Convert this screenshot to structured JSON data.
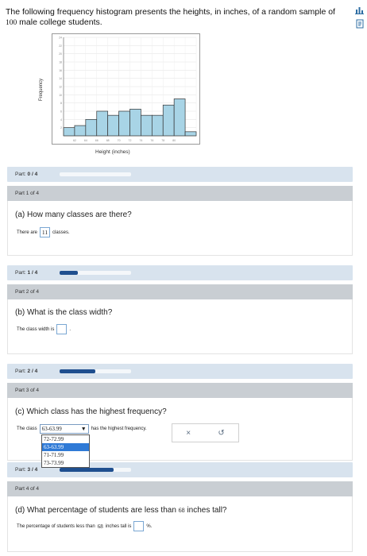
{
  "intro": {
    "text_before": "The following frequency histogram presents the heights, in inches, of a random sample of",
    "sample_size": "100",
    "text_after": "male college students."
  },
  "icons": [
    "chart-icon",
    "notes-icon"
  ],
  "chart_data": {
    "type": "bar",
    "xlabel": "Height (inches)",
    "ylabel": "Frequency",
    "x_ticks": [
      "62",
      "64",
      "66",
      "68",
      "70",
      "72",
      "74",
      "76",
      "78",
      "80"
    ],
    "y_ticks": [
      "2",
      "4",
      "6",
      "8",
      "10",
      "12",
      "14",
      "16",
      "18",
      "20",
      "22",
      "24"
    ],
    "ylim": [
      0,
      24
    ],
    "values": [
      2,
      2.5,
      4,
      6,
      5,
      6,
      6.5,
      5,
      5,
      7.5,
      9,
      1
    ],
    "colors": {
      "bar": "#a8d4e6",
      "edge": "#333333"
    }
  },
  "parts": [
    {
      "status": "Part:",
      "progress": "0 / 4",
      "fraction": 0.0,
      "header": "Part 1 of 4",
      "question": "(a) How many classes are there?",
      "answer_before": "There are",
      "answer_value": "11",
      "answer_after": "classes."
    },
    {
      "status": "Part:",
      "progress": "1 / 4",
      "fraction": 0.25,
      "header": "Part 2 of 4",
      "question": "(b) What is the class width?",
      "answer_before": "The class width is",
      "answer_after": "."
    },
    {
      "status": "Part:",
      "progress": "2 / 4",
      "fraction": 0.5,
      "header": "Part 3 of 4",
      "question": "(c) Which class has the highest frequency?",
      "answer_before": "The class",
      "selected": "63-63.99",
      "answer_after": "has the highest frequency.",
      "options": [
        "72-72.99",
        "63-63.99",
        "71-71.99",
        "73-73.99"
      ],
      "tools": {
        "clear": "×",
        "undo": "↺"
      }
    },
    {
      "status": "Part:",
      "progress": "3 / 4",
      "fraction": 0.75,
      "header": "Part 4 of 4",
      "question_before": "(d) What percentage of students are less than",
      "question_num": "68",
      "question_after": "inches tall?",
      "answer_before": "The percentage of students less than",
      "answer_num": "68",
      "answer_mid": "inches tall is",
      "answer_after": "%."
    }
  ]
}
